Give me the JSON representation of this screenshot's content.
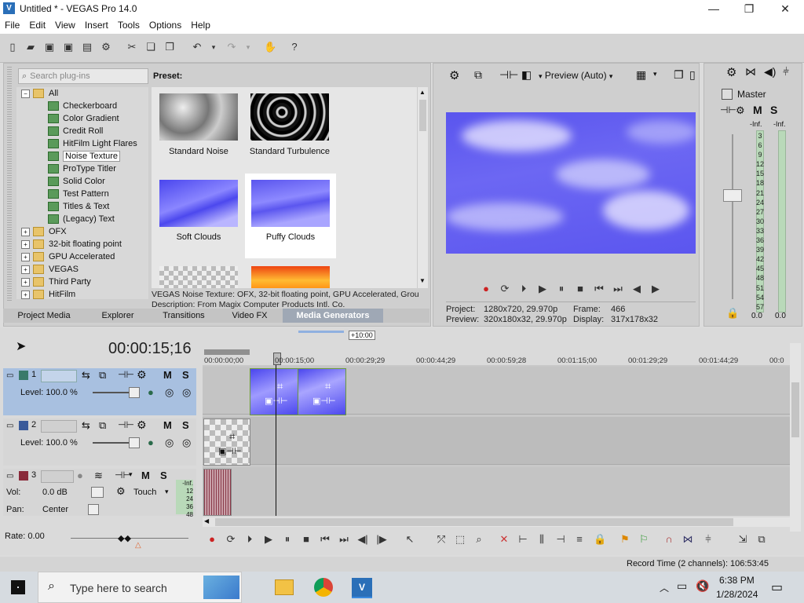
{
  "window": {
    "title": "Untitled * - VEGAS Pro 14.0"
  },
  "menu": [
    "File",
    "Edit",
    "View",
    "Insert",
    "Tools",
    "Options",
    "Help"
  ],
  "plugins": {
    "search_placeholder": "Search plug-ins",
    "tree": [
      {
        "label": "All",
        "kind": "folder",
        "expanded": true
      },
      {
        "label": "Checkerboard",
        "kind": "fx"
      },
      {
        "label": "Color Gradient",
        "kind": "fx"
      },
      {
        "label": "Credit Roll",
        "kind": "fx"
      },
      {
        "label": "HitFilm Light Flares",
        "kind": "fx"
      },
      {
        "label": "Noise Texture",
        "kind": "fx",
        "selected": true
      },
      {
        "label": "ProType Titler",
        "kind": "fx"
      },
      {
        "label": "Solid Color",
        "kind": "fx"
      },
      {
        "label": "Test Pattern",
        "kind": "fx"
      },
      {
        "label": "Titles & Text",
        "kind": "fx"
      },
      {
        "label": "(Legacy) Text",
        "kind": "fx"
      },
      {
        "label": "OFX",
        "kind": "folder"
      },
      {
        "label": "32-bit floating point",
        "kind": "folder"
      },
      {
        "label": "GPU Accelerated",
        "kind": "folder"
      },
      {
        "label": "VEGAS",
        "kind": "folder"
      },
      {
        "label": "Third Party",
        "kind": "folder"
      },
      {
        "label": "HitFilm",
        "kind": "folder"
      }
    ],
    "preset_label": "Preset:",
    "presets": [
      {
        "label": "Standard Noise"
      },
      {
        "label": "Standard Turbulence"
      },
      {
        "label": "Soft Clouds"
      },
      {
        "label": "Puffy Clouds",
        "selected": true
      }
    ],
    "description_line1": "VEGAS Noise Texture: OFX, 32-bit floating point, GPU Accelerated, Grou",
    "description_line2": "Description: From Magix Computer Products Intl. Co.",
    "tabs": [
      "Project Media",
      "Explorer",
      "Transitions",
      "Video FX",
      "Media Generators"
    ],
    "active_tab": "Media Generators"
  },
  "preview": {
    "mode": "Preview (Auto)",
    "project_label": "Project:",
    "project_value": "1280x720, 29.970p",
    "frame_label": "Frame:",
    "frame_value": "466",
    "preview_label": "Preview:",
    "preview_value": "320x180x32, 29.970p",
    "display_label": "Display:",
    "display_value": "317x178x32"
  },
  "mixer": {
    "title": "Master",
    "ticks": [
      "3",
      "6",
      "9",
      "12",
      "15",
      "18",
      "21",
      "24",
      "27",
      "30",
      "33",
      "36",
      "39",
      "42",
      "45",
      "48",
      "51",
      "54",
      "57"
    ],
    "left_peak": "-Inf.",
    "right_peak": "-Inf.",
    "left_val": "0.0",
    "right_val": "0.0"
  },
  "timeline": {
    "timecode": "00:00:15;16",
    "zoom_badge": "+10:00",
    "ruler": [
      "00:00:00;00",
      "00:00:15;00",
      "00:00:29;29",
      "00:00:44;29",
      "00:00:59;28",
      "00:01:15;00",
      "00:01:29;29",
      "00:01:44;29",
      "00:0"
    ],
    "tracks": [
      {
        "num": "1",
        "level": "Level: 100.0 %"
      },
      {
        "num": "2",
        "level": "Level: 100.0 %"
      },
      {
        "num": "3",
        "vol_label": "Vol:",
        "vol_value": "0.0 dB",
        "pan_label": "Pan:",
        "pan_value": "Center",
        "touch": "Touch",
        "meter_ticks": [
          "-Inf.",
          "12",
          "24",
          "36",
          "48"
        ]
      }
    ],
    "rate": "Rate: 0.00",
    "record_time": "Record Time (2 channels): 106:53:45"
  },
  "taskbar": {
    "search_placeholder": "Type here to search",
    "time": "6:38 PM",
    "date": "1/28/2024"
  },
  "colors": {
    "preview_sky": "#5a55ee",
    "track_selected": "#a8c0e0",
    "clip_border": "#6a9a3a"
  }
}
